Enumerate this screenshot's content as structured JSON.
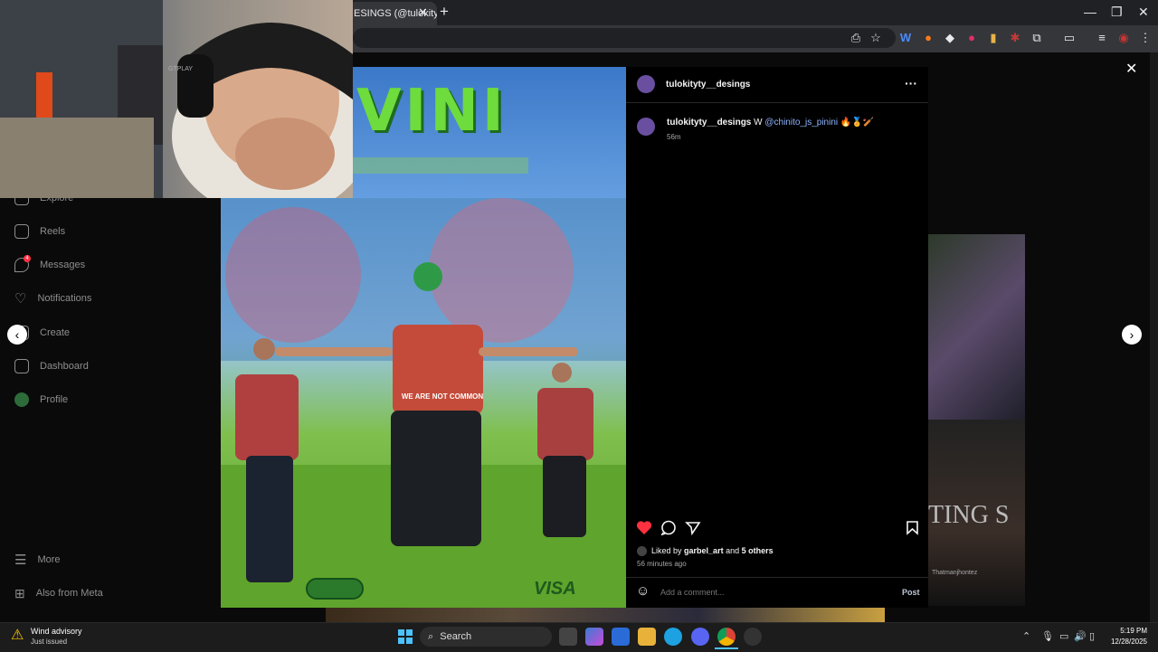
{
  "browser": {
    "tab_title": "ESINGS (@tulokityt",
    "tab_close": "✕",
    "new_tab": "+",
    "window_controls": [
      "—",
      "❐",
      "✕"
    ]
  },
  "sidebar": {
    "items": [
      {
        "label": "Explore",
        "icon": "explore-icon"
      },
      {
        "label": "Reels",
        "icon": "reels-icon"
      },
      {
        "label": "Messages",
        "icon": "messages-icon",
        "badge": "4"
      },
      {
        "label": "Notifications",
        "icon": "heart-icon"
      },
      {
        "label": "Create",
        "icon": "create-icon"
      },
      {
        "label": "Dashboard",
        "icon": "dashboard-icon"
      },
      {
        "label": "Profile",
        "icon": "profile-icon"
      }
    ],
    "more": "More",
    "also_from_meta": "Also from Meta"
  },
  "post": {
    "header_username": "tulokityty__desings",
    "more_options": "···",
    "caption_username": "tulokityty__desings",
    "caption_text": "W",
    "caption_mention": "@chinito_js_pinini",
    "caption_emojis": "🔥🏅🏏",
    "caption_time": "56m",
    "liked_by_prefix": "Liked by",
    "liked_by_user": "garbel_art",
    "liked_by_and": "and",
    "liked_by_others": "5 others",
    "post_time": "56 minutes ago",
    "comment_placeholder": "Add a comment...",
    "post_button": "Post",
    "image_text_top": "VINI",
    "image_text_shirt": "WE ARE NOT COMMON",
    "image_text_visa": "VISA",
    "like_color": "#ff3040"
  },
  "modal": {
    "close": "✕",
    "prev": "‹",
    "next": "›"
  },
  "thumbnails": {
    "thumb2_text": "TING S",
    "thumb2_caption": "Thatmanjhontez"
  },
  "webcam": {
    "headset_text": "GTPLAY"
  },
  "taskbar": {
    "weather_title": "Wind advisory",
    "weather_sub": "Just issued",
    "search": "Search",
    "time": "5:19 PM",
    "date": "12/28/2025"
  }
}
